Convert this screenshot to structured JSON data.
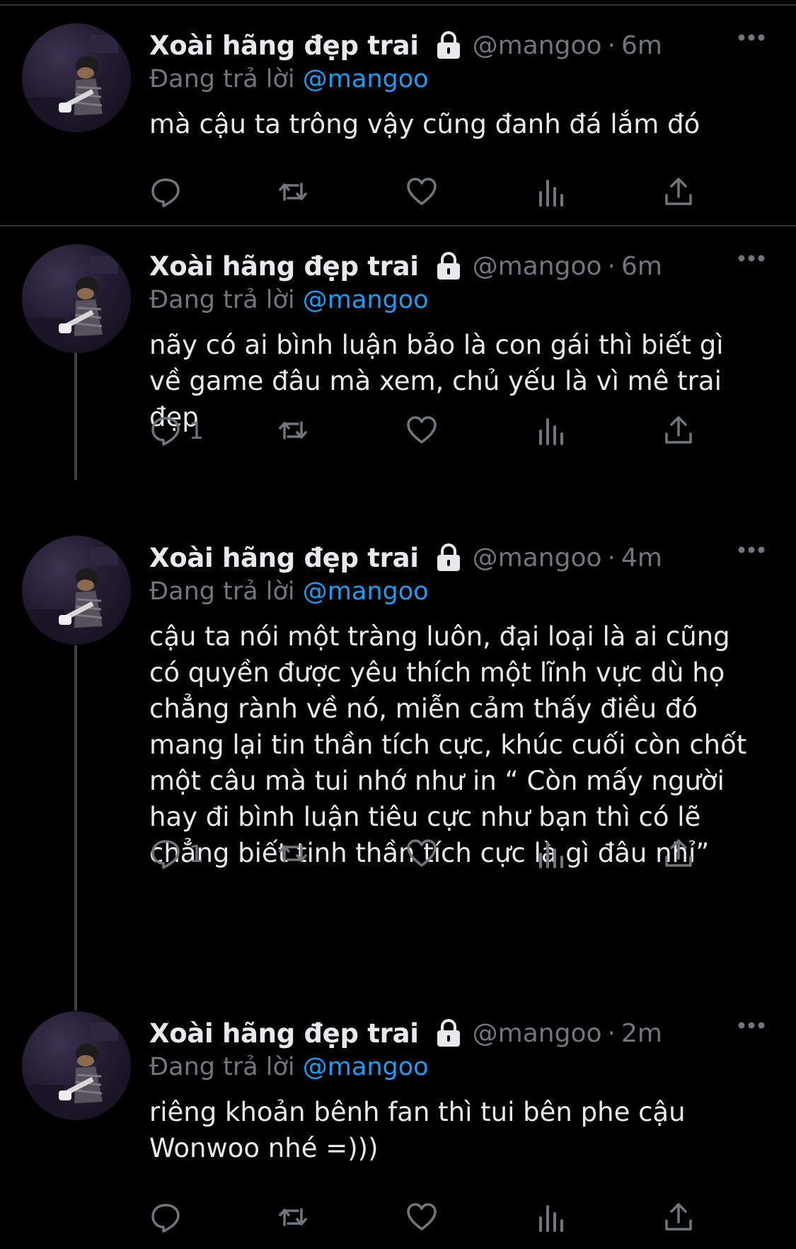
{
  "tweets": [
    {
      "display_name": "Xoài hãng đẹp trai",
      "handle": "@mangoo",
      "separator": "·",
      "time": "6m",
      "replying_prefix": "Đang trả lời",
      "replying_to": "@mangoo",
      "text": "mà cậu ta trông vậy cũng đanh đá lắm đó",
      "reply_count": ""
    },
    {
      "display_name": "Xoài hãng đẹp trai",
      "handle": "@mangoo",
      "separator": "·",
      "time": "6m",
      "replying_prefix": "Đang trả lời",
      "replying_to": "@mangoo",
      "text": "nãy có ai bình luận bảo là con gái thì biết gì về game đâu mà xem, chủ yếu là vì mê trai đẹp",
      "reply_count": "1"
    },
    {
      "display_name": "Xoài hãng đẹp trai",
      "handle": "@mangoo",
      "separator": "·",
      "time": "4m",
      "replying_prefix": "Đang trả lời",
      "replying_to": "@mangoo",
      "text": "cậu ta nói một tràng luôn, đại loại là ai cũng có quyền được yêu thích một lĩnh vực dù họ chẳng rành về nó, miễn cảm thấy điều đó mang lại tin thần tích cực, khúc cuối còn chốt một câu mà tui nhớ như in “ Còn mấy người hay đi bình luận tiêu cực như bạn thì có lẽ chẳng biết tinh thần tích cực là gì đâu nhỉ”",
      "reply_count": "1"
    },
    {
      "display_name": "Xoài hãng đẹp trai",
      "handle": "@mangoo",
      "separator": "·",
      "time": "2m",
      "replying_prefix": "Đang trả lời",
      "replying_to": "@mangoo",
      "text": "riêng khoản bênh fan thì tui bên phe cậu Wonwoo nhé =)))",
      "reply_count": ""
    }
  ],
  "icons": {
    "lock": "lock-icon",
    "more": "more-icon",
    "reply": "reply-icon",
    "retweet": "retweet-icon",
    "like": "heart-icon",
    "views": "views-icon",
    "share": "share-icon"
  },
  "colors": {
    "background": "#000000",
    "text": "#e7e9ea",
    "muted": "#71767b",
    "mention": "#1d9bf0",
    "divider": "#2f3336"
  }
}
